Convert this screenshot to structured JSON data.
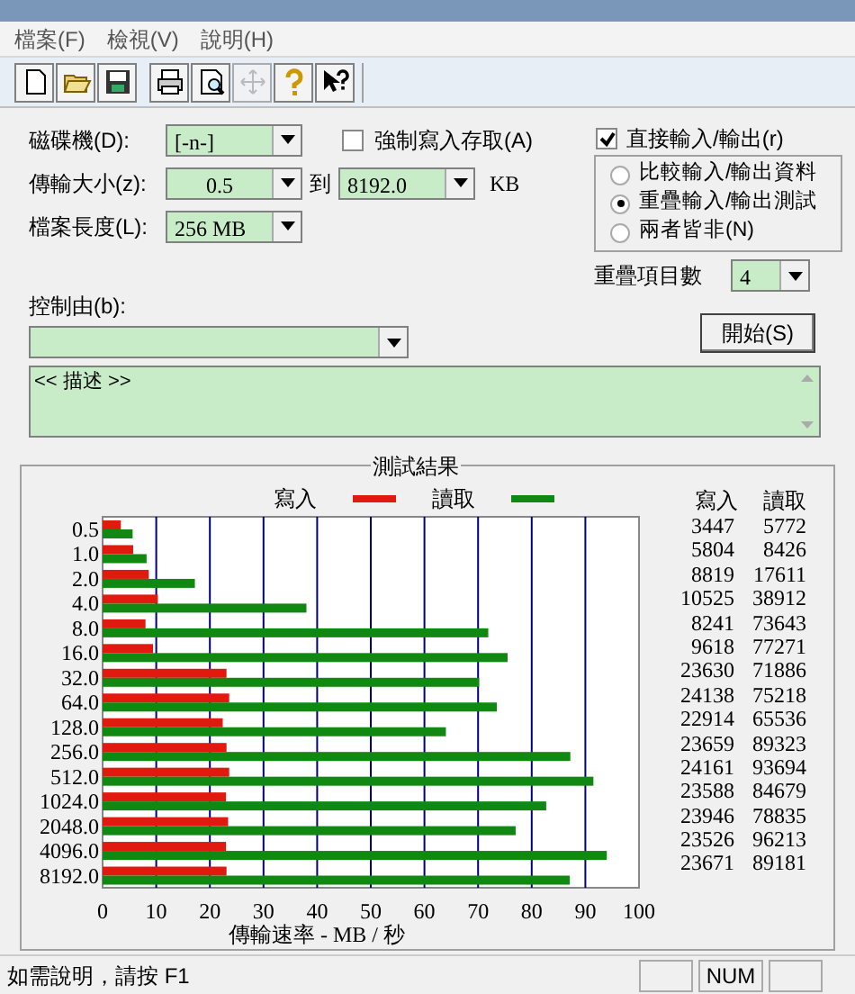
{
  "menu": [
    "檔案(F)",
    "檢視(V)",
    "說明(H)"
  ],
  "toolbar": [
    {
      "kind": "new",
      "disabled": false
    },
    {
      "kind": "open",
      "disabled": false
    },
    {
      "kind": "save",
      "disabled": false
    },
    {
      "kind": "print",
      "disabled": false
    },
    {
      "kind": "preview",
      "disabled": false
    },
    {
      "kind": "move",
      "disabled": true
    },
    {
      "kind": "help",
      "disabled": false
    },
    {
      "kind": "context_help",
      "disabled": false
    }
  ],
  "drive": {
    "label": "磁碟機(D):",
    "value": "[-n-]"
  },
  "force_write": {
    "label": "強制寫入存取(A)",
    "checked": false
  },
  "direct_io": {
    "label": "直接輸入/輸出(r)",
    "checked": true
  },
  "transfer_size": {
    "label": "傳輸大小(z):",
    "from": "0.5",
    "to_label": "到",
    "to": "8192.0",
    "unit": "KB"
  },
  "file_length": {
    "label": "檔案長度(L):",
    "value": "256 MB"
  },
  "io_mode": [
    {
      "label": "比較輸入/輸出資料",
      "selected": false
    },
    {
      "label": "重疊輸入/輸出測試",
      "selected": true
    },
    {
      "label": "兩者皆非(N)",
      "selected": false
    }
  ],
  "queue_depth": {
    "label": "重疊項目數",
    "value": "4"
  },
  "controlled_by": {
    "label": "控制由(b):"
  },
  "start_button": "開始(S)",
  "description": "<< 描述 >>",
  "results": {
    "title": "測試結果",
    "table_headers": [
      "寫入",
      "讀取"
    ],
    "rows": [
      [
        "3447",
        "5772"
      ],
      [
        "5804",
        "8426"
      ],
      [
        "8819",
        "17611"
      ],
      [
        "10525",
        "38912"
      ],
      [
        "8241",
        "73643"
      ],
      [
        "9618",
        "77271"
      ],
      [
        "23630",
        "71886"
      ],
      [
        "24138",
        "75218"
      ],
      [
        "22914",
        "65536"
      ],
      [
        "23659",
        "89323"
      ],
      [
        "24161",
        "93694"
      ],
      [
        "23588",
        "84679"
      ],
      [
        "23946",
        "78835"
      ],
      [
        "23526",
        "96213"
      ],
      [
        "23671",
        "89181"
      ]
    ],
    "chart_data": {
      "type": "bar",
      "orientation": "horizontal",
      "xlabel": "傳輸速率 - MB / 秒",
      "categories": [
        "0.5",
        "1.0",
        "2.0",
        "4.0",
        "8.0",
        "16.0",
        "32.0",
        "64.0",
        "128.0",
        "256.0",
        "512.0",
        "1024.0",
        "2048.0",
        "4096.0",
        "8192.0"
      ],
      "xlim": [
        0,
        100
      ],
      "grid": true,
      "xticks": [
        0,
        10,
        20,
        30,
        40,
        50,
        60,
        70,
        80,
        90,
        100
      ],
      "series": [
        {
          "name": "寫入",
          "color": "#e11a10",
          "values": [
            3.4,
            5.7,
            8.6,
            10.3,
            8.0,
            9.4,
            23.1,
            23.6,
            22.4,
            23.1,
            23.6,
            23.0,
            23.4,
            23.0,
            23.1
          ]
        },
        {
          "name": "讀取",
          "color": "#118811",
          "values": [
            5.6,
            8.2,
            17.2,
            38.0,
            71.9,
            75.5,
            70.2,
            73.5,
            64.0,
            87.2,
            91.5,
            82.7,
            77.0,
            94.0,
            87.1
          ]
        }
      ]
    }
  },
  "status_bar": {
    "text": "如需說明，請按 F1",
    "num_indicator": "NUM"
  }
}
